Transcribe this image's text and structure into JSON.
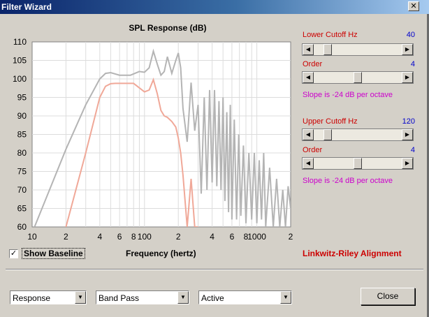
{
  "window": {
    "title": "Filter Wizard",
    "close_glyph": "✕"
  },
  "chart_data": {
    "type": "line",
    "title": "SPL Response (dB)",
    "xlabel": "Frequency (hertz)",
    "ylabel": "",
    "x_scale": "log",
    "xlim": [
      10,
      2000
    ],
    "ylim": [
      60,
      110
    ],
    "grid": true,
    "yticks": [
      60,
      65,
      70,
      75,
      80,
      85,
      90,
      95,
      100,
      105,
      110
    ],
    "xticks": [
      {
        "value": 10,
        "label": "10"
      },
      {
        "value": 20,
        "label": "2"
      },
      {
        "value": 40,
        "label": "4"
      },
      {
        "value": 60,
        "label": "6"
      },
      {
        "value": 80,
        "label": "8"
      },
      {
        "value": 100,
        "label": "100"
      },
      {
        "value": 200,
        "label": "2"
      },
      {
        "value": 400,
        "label": "4"
      },
      {
        "value": 600,
        "label": "6"
      },
      {
        "value": 800,
        "label": "8"
      },
      {
        "value": 1000,
        "label": "1000"
      },
      {
        "value": 2000,
        "label": "2"
      }
    ],
    "series": [
      {
        "color": "#b4b4b4",
        "x": [
          10.5,
          20,
          30,
          40,
          45,
          50,
          60,
          75,
          90,
          100,
          110,
          120,
          130,
          140,
          150,
          160,
          175,
          190,
          200,
          210,
          220,
          240,
          260,
          280,
          300,
          320,
          340,
          360,
          380,
          400,
          420,
          440,
          460,
          480,
          500,
          520,
          540,
          560,
          580,
          600,
          630,
          660,
          690,
          720,
          760,
          800,
          850,
          900,
          950,
          1000,
          1050,
          1100,
          1150,
          1200,
          1300,
          1400,
          1500,
          1600,
          1700,
          1800,
          1900,
          2000
        ],
        "y": [
          60,
          81,
          93,
          100,
          101.5,
          101.7,
          101,
          101,
          102,
          101.8,
          103,
          107.5,
          104,
          101,
          102,
          106,
          101.5,
          105,
          107,
          103,
          92,
          83,
          99,
          86,
          93,
          69,
          95,
          70,
          97,
          72,
          97,
          71,
          94,
          70,
          95,
          67,
          91,
          64,
          93,
          62,
          89,
          62,
          85,
          63,
          82,
          61,
          80,
          62,
          80,
          61,
          78,
          62,
          80,
          60,
          76,
          60,
          73,
          60,
          70,
          60,
          71,
          65
        ],
        "name": ""
      },
      {
        "color": "#f0a898",
        "x": [
          20,
          30,
          40,
          45,
          50,
          55,
          60,
          80,
          100,
          110,
          120,
          130,
          140,
          150,
          160,
          175,
          190,
          200,
          210,
          220,
          240,
          260,
          280,
          300
        ],
        "y": [
          60,
          80,
          95,
          98,
          98.7,
          98.8,
          98.8,
          98.8,
          96.5,
          97,
          99.8,
          96,
          91.5,
          90,
          89.6,
          88.5,
          87,
          84,
          80,
          74,
          60,
          73,
          60,
          60
        ],
        "name": ""
      }
    ]
  },
  "show_baseline": {
    "label": "Show Baseline",
    "checked": true,
    "check_glyph": "✓"
  },
  "lower_cutoff": {
    "label": "Lower Cutoff  Hz",
    "value": "40",
    "position": 0.12,
    "order_label": "Order",
    "order_value": "4",
    "order_position": 0.5,
    "slope_text": "Slope is -24 dB per octave"
  },
  "upper_cutoff": {
    "label": "Upper Cutoff  Hz",
    "value": "120",
    "position": 0.12,
    "order_label": "Order",
    "order_value": "4",
    "order_position": 0.5,
    "slope_text": "Slope is -24 dB per octave"
  },
  "alignment_label": "Linkwitz-Riley Alignment",
  "dropdowns": {
    "view": "Response",
    "filter_type": "Band Pass",
    "mode": "Active"
  },
  "arrows": {
    "left": "◀",
    "right": "▶",
    "down": "▼"
  },
  "close_button": "Close",
  "colors": {
    "title_start": "#0a246a",
    "title_end": "#a6caf0",
    "label_red": "#cc0000",
    "value_blue": "#0000cc",
    "slope_magenta": "#cc00cc"
  }
}
